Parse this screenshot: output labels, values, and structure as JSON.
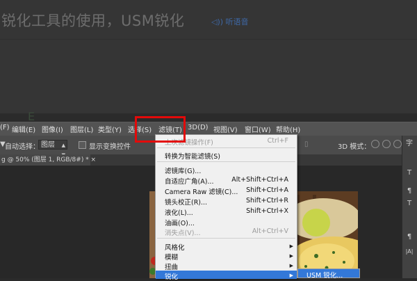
{
  "tutorial": {
    "title": "锐化工具的使用，USM锐化",
    "audio_link": "◁)) 听语音"
  },
  "menubar": {
    "items": [
      "(F)",
      "编辑(E)",
      "图像(I)",
      "图层(L)",
      "类型(Y)",
      "选择(S)",
      "滤镜(T)",
      "3D(D)",
      "视图(V)",
      "窗口(W)",
      "帮助(H)"
    ]
  },
  "options_bar": {
    "auto_select_label": "自动选择：",
    "auto_select_checked": true,
    "layer_select_value": "图层",
    "show_transform_label": "显示变换控件",
    "mode_3d_label": "3D 模式："
  },
  "document_tab": {
    "label": "g @ 50% (图层 1, RGB/8#) *  ×"
  },
  "filter_menu": {
    "last_filter": {
      "label": "上次滤镜操作(F)",
      "shortcut": "Ctrl+F",
      "disabled": true
    },
    "convert_smart": {
      "label": "转换为智能滤镜(S)"
    },
    "gallery": {
      "label": "滤镜库(G)..."
    },
    "adaptive_wide": {
      "label": "自适应广角(A)...",
      "shortcut": "Alt+Shift+Ctrl+A"
    },
    "camera_raw": {
      "label": "Camera Raw 滤镜(C)...",
      "shortcut": "Shift+Ctrl+A"
    },
    "lens_correction": {
      "label": "镜头校正(R)...",
      "shortcut": "Shift+Ctrl+R"
    },
    "liquify": {
      "label": "液化(L)...",
      "shortcut": "Shift+Ctrl+X"
    },
    "oil_paint": {
      "label": "油画(O)..."
    },
    "vanishing_point": {
      "label": "消失点(V)...",
      "shortcut": "Alt+Ctrl+V",
      "disabled": true
    },
    "stylize": {
      "label": "风格化"
    },
    "blur": {
      "label": "模糊"
    },
    "distort": {
      "label": "扭曲"
    },
    "sharpen": {
      "label": "锐化"
    }
  },
  "submenu": {
    "usm": {
      "label": "USM 锐化..."
    }
  },
  "right_panel": {
    "tab_label": "字",
    "tools": [
      "T",
      "¶",
      "T",
      "¶",
      "|A|"
    ]
  },
  "colors": {
    "highlight": "#3378d8",
    "callout": "#e30a0a"
  }
}
